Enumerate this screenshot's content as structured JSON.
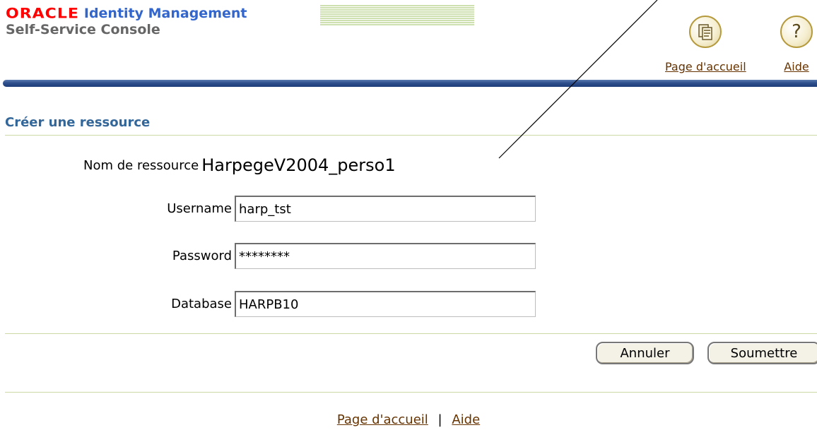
{
  "branding": {
    "oracle_logo": "ORACLE",
    "product": "Identity Management",
    "console": "Self-Service Console"
  },
  "global_buttons": {
    "home": {
      "label": "Page d'accueil",
      "icon": "home-icon"
    },
    "help": {
      "label": "Aide",
      "icon": "help-icon",
      "glyph": "?"
    }
  },
  "page": {
    "title": "Créer une ressource"
  },
  "form": {
    "resource_name_label": "Nom de ressource",
    "resource_name_value": "HarpegeV2004_perso1",
    "username_label": "Username",
    "username_value": "harp_tst",
    "password_label": "Password",
    "password_value": "********",
    "database_label": "Database",
    "database_value": "HARPB10"
  },
  "actions": {
    "cancel_label": "Annuler",
    "submit_label": "Soumettre"
  },
  "footer": {
    "home_link": "Page d'accueil",
    "separator": "|",
    "help_link": "Aide"
  },
  "colors": {
    "oracle_red": "#ff0000",
    "product_blue": "#3366cc",
    "title_blue": "#336699",
    "link_brown": "#663300",
    "bar_blue": "#1b3c78",
    "rule_green": "#ccd9a5"
  }
}
